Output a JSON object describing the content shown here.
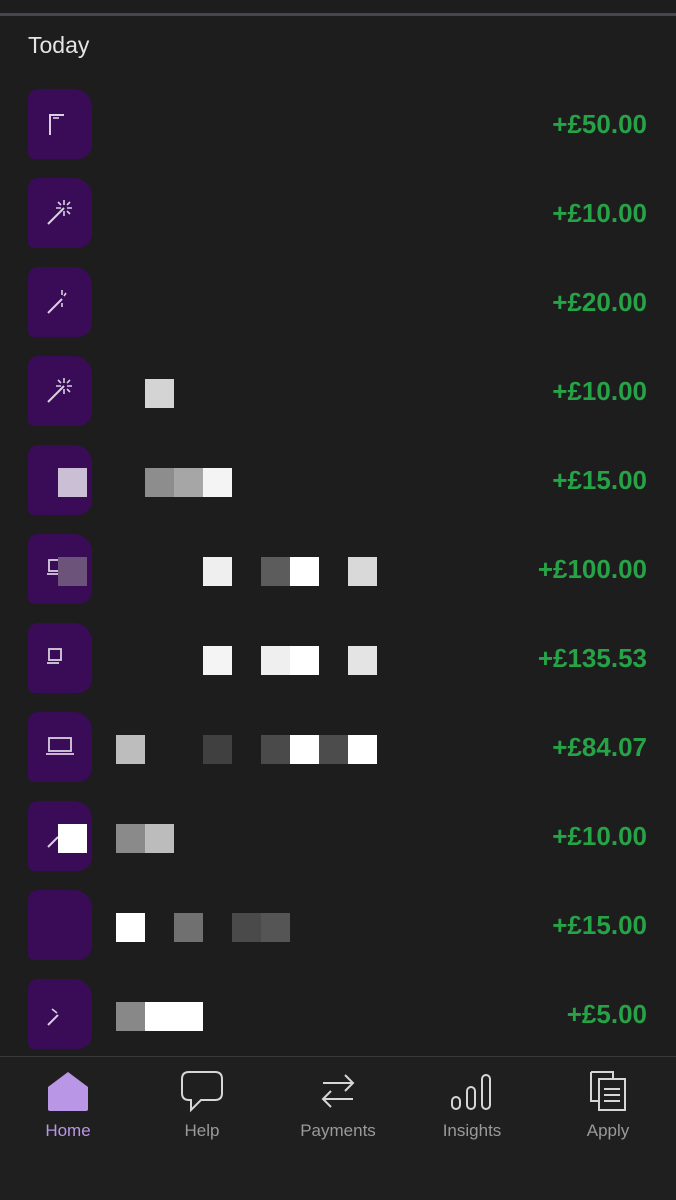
{
  "section": {
    "title": "Today"
  },
  "transactions": [
    {
      "icon": "card-icon",
      "amount": "+£50.00"
    },
    {
      "icon": "magic-wand-icon",
      "amount": "+£10.00"
    },
    {
      "icon": "magic-wand-icon",
      "amount": "+£20.00"
    },
    {
      "icon": "magic-wand-icon",
      "amount": "+£10.00"
    },
    {
      "icon": "transaction-icon",
      "amount": "+£15.00"
    },
    {
      "icon": "laptop-icon",
      "amount": "+£100.00"
    },
    {
      "icon": "laptop-icon",
      "amount": "+£135.53"
    },
    {
      "icon": "laptop-icon",
      "amount": "+£84.07"
    },
    {
      "icon": "magic-wand-icon",
      "amount": "+£10.00"
    },
    {
      "icon": "transaction-icon",
      "amount": "+£15.00"
    },
    {
      "icon": "magic-wand-icon",
      "amount": "+£5.00"
    }
  ],
  "tabs": [
    {
      "label": "Home",
      "icon": "home-icon",
      "active": true
    },
    {
      "label": "Help",
      "icon": "chat-bubble-icon",
      "active": false
    },
    {
      "label": "Payments",
      "icon": "transfer-arrows-icon",
      "active": false
    },
    {
      "label": "Insights",
      "icon": "bar-chart-icon",
      "active": false
    },
    {
      "label": "Apply",
      "icon": "documents-icon",
      "active": false
    }
  ],
  "colors": {
    "background": "#1d1d1d",
    "icon_tile": "#3a0b56",
    "amount_positive": "#27a347",
    "tab_active": "#b996e6",
    "tab_inactive": "#9a9a9a"
  }
}
